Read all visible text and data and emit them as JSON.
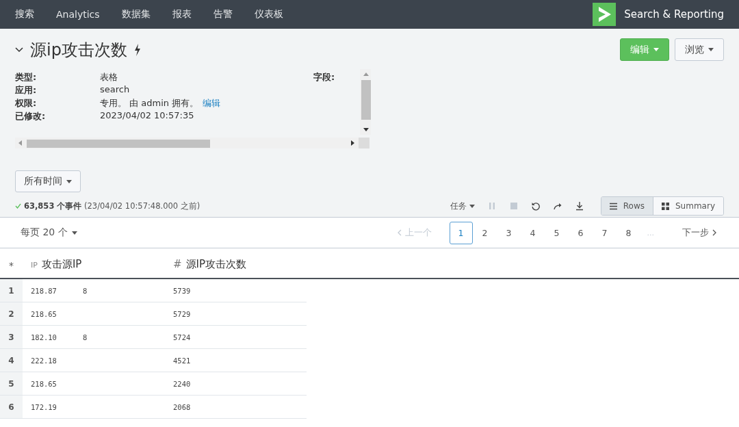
{
  "nav": {
    "items": [
      {
        "label": "搜索"
      },
      {
        "label": "Analytics"
      },
      {
        "label": "数据集"
      },
      {
        "label": "报表"
      },
      {
        "label": "告警"
      },
      {
        "label": "仪表板"
      }
    ],
    "app_name": "Search & Reporting"
  },
  "report": {
    "title": "源ip攻击次数",
    "expanded": true,
    "meta": [
      {
        "label": "类型:",
        "value": "表格"
      },
      {
        "label": "应用:",
        "value": "search"
      },
      {
        "label": "权限:",
        "value": "专用。 由 admin 拥有。",
        "link": "编辑"
      },
      {
        "label": "已修改:",
        "value": "2023/04/02 10:57:35"
      }
    ],
    "fields_label": "字段:",
    "buttons": [
      {
        "label": "编辑",
        "kind": "primary"
      },
      {
        "label": "浏览",
        "kind": "default"
      }
    ]
  },
  "time_picker": "所有时间",
  "status": {
    "count": "63,853 个事件",
    "detail": "(23/04/02 10:57:48.000 之前)"
  },
  "job_menu": "任务",
  "job_actions": [
    {
      "kind": "pause",
      "disabled": true
    },
    {
      "kind": "stop",
      "disabled": true
    },
    {
      "kind": "refresh",
      "disabled": false
    },
    {
      "kind": "share",
      "disabled": false
    },
    {
      "kind": "download",
      "disabled": false
    }
  ],
  "views": [
    {
      "label": "Rows",
      "kind": "rows",
      "selected": true
    },
    {
      "label": "Summary",
      "kind": "summary",
      "selected": false
    }
  ],
  "page_size": "每页 20 个",
  "pager": {
    "prev": "上一个",
    "prev_disabled": true,
    "next": "下一步",
    "pages": [
      {
        "label": "1",
        "selected": true
      },
      {
        "label": "2",
        "selected": false
      },
      {
        "label": "3",
        "selected": false
      },
      {
        "label": "4",
        "selected": false
      },
      {
        "label": "5",
        "selected": false
      },
      {
        "label": "6",
        "selected": false
      },
      {
        "label": "7",
        "selected": false
      },
      {
        "label": "8",
        "selected": false
      }
    ],
    "ellipsis": "..."
  },
  "table": {
    "index_header": "*",
    "columns": [
      {
        "type_tag": "IP",
        "label": "攻击源IP"
      },
      {
        "type_tag": "#",
        "label": "源IP攻击次数"
      }
    ],
    "rows": [
      {
        "index": "1",
        "ip_start": "218.87",
        "ip_end": "8",
        "count": "5739"
      },
      {
        "index": "2",
        "ip_start": "218.65",
        "count": "5729"
      },
      {
        "index": "3",
        "ip_start": "182.10",
        "ip_end": "8",
        "count": "5724"
      },
      {
        "index": "4",
        "ip_start": "222.18",
        "count": "4521"
      },
      {
        "index": "5",
        "ip_start": "218.65",
        "count": "2240"
      },
      {
        "index": "6",
        "ip_start": "172.19",
        "count": "2068"
      }
    ]
  }
}
